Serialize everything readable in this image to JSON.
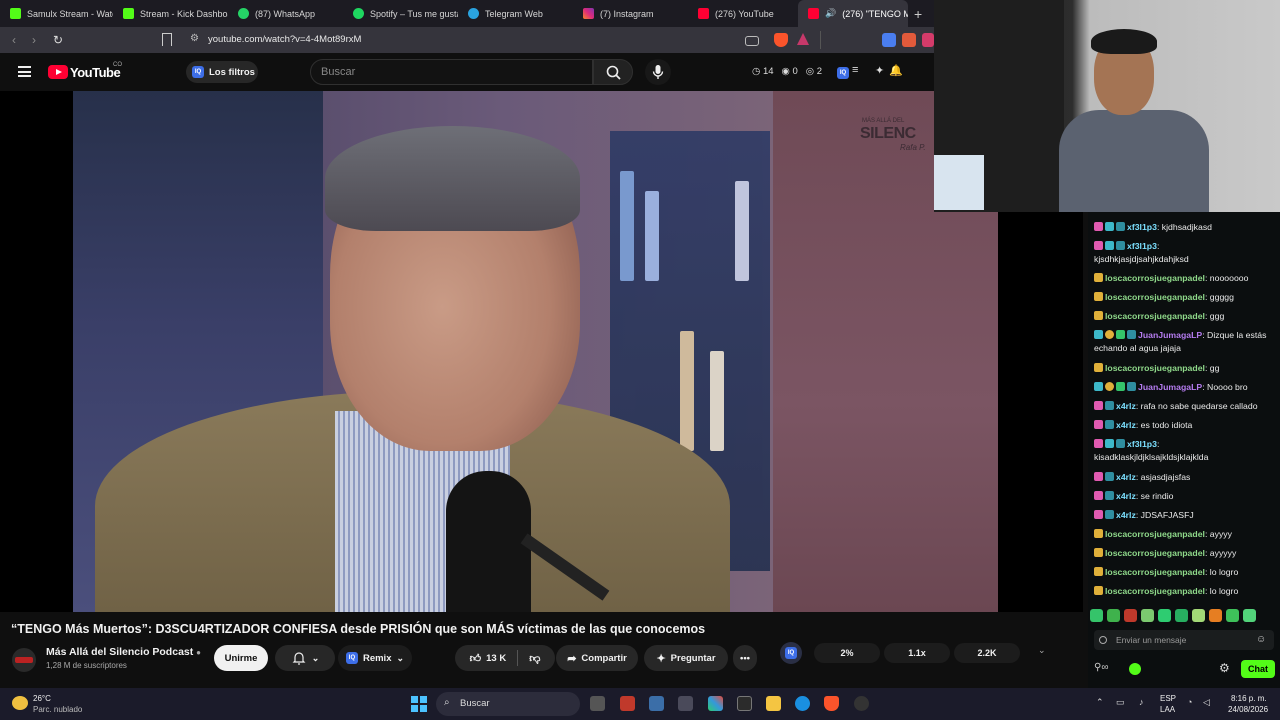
{
  "browser": {
    "tabs": [
      {
        "label": "Samulx Stream - Watch",
        "color": "#53fc18"
      },
      {
        "label": "Stream - Kick Dashboa",
        "color": "#53fc18"
      },
      {
        "label": "(87) WhatsApp",
        "color": "#25d366"
      },
      {
        "label": "Spotify – Tus me gusta",
        "color": "#1ed760"
      },
      {
        "label": "Telegram Web",
        "color": "#2aa3df"
      },
      {
        "label": "(7) Instagram",
        "color": "#e1306c"
      },
      {
        "label": "(276) YouTube",
        "color": "#ff0033"
      },
      {
        "label": "(276) \"TENGO M",
        "color": "#ff0033"
      }
    ],
    "url": "youtube.com/watch?v=4-4Mot89rxM"
  },
  "youtube": {
    "logo_text": "YouTube",
    "logo_country": "CO",
    "filters_label": "Los filtros",
    "search_placeholder": "Buscar",
    "counters": {
      "a": "14",
      "b": "0",
      "c": "2"
    }
  },
  "video": {
    "watermark_small": "MÁS ALLÁ DEL",
    "watermark_title": "SILENC",
    "watermark_sign": "Rafa P.",
    "title": "“TENGO Más Muertos”: D3SCU4RTIZADOR CONFIESA desde PRISIÓN que son MÁS víctimas de las que conocemos",
    "channel_name": "Más Allá del Silencio Podcast",
    "subscribers": "1,28 M de suscriptores",
    "join_label": "Unirme",
    "remix_label": "Remix",
    "likes": "13 K",
    "share_label": "Compartir",
    "ask_label": "Preguntar",
    "iq_stats": {
      "iq": "IQ",
      "percent": "2%",
      "speed": "1.1x",
      "count": "2.2K"
    }
  },
  "chat": {
    "messages": [
      {
        "user": "xf3l1p3",
        "text": "kjdhsadjkasd",
        "user_color": "#7ce0ff"
      },
      {
        "user": "xf3l1p3",
        "text": "kjsdhkjasjdjsahjkdahjksd",
        "user_color": "#7ce0ff"
      },
      {
        "user": "loscacorrosjueganpadel",
        "text": "nooooooo",
        "user_color": "#8fd98a"
      },
      {
        "user": "loscacorrosjueganpadel",
        "text": "ggggg",
        "user_color": "#8fd98a"
      },
      {
        "user": "loscacorrosjueganpadel",
        "text": "ggg",
        "user_color": "#8fd98a"
      },
      {
        "user": "JuanJumagaLP",
        "text": "Dizque la estás echando al agua jajaja",
        "user_color": "#b57cf0"
      },
      {
        "user": "loscacorrosjueganpadel",
        "text": "gg",
        "user_color": "#8fd98a"
      },
      {
        "user": "JuanJumagaLP",
        "text": "Noooo bro",
        "user_color": "#b57cf0"
      },
      {
        "user": "x4rlz",
        "text": "rafa no sabe quedarse callado",
        "user_color": "#7ce0ff"
      },
      {
        "user": "x4rlz",
        "text": "es todo idiota",
        "user_color": "#7ce0ff"
      },
      {
        "user": "xf3l1p3",
        "text": "kisadklaskjldjklsajkldsjklajklda",
        "user_color": "#7ce0ff"
      },
      {
        "user": "x4rlz",
        "text": "asjasdjajsfas",
        "user_color": "#7ce0ff"
      },
      {
        "user": "x4rlz",
        "text": "se rindio",
        "user_color": "#7ce0ff"
      },
      {
        "user": "x4rlz",
        "text": "JDSAFJASFJ",
        "user_color": "#7ce0ff"
      },
      {
        "user": "loscacorrosjueganpadel",
        "text": "ayyyy",
        "user_color": "#8fd98a"
      },
      {
        "user": "loscacorrosjueganpadel",
        "text": "ayyyyy",
        "user_color": "#8fd98a"
      },
      {
        "user": "loscacorrosjueganpadel",
        "text": "lo logro",
        "user_color": "#8fd98a"
      },
      {
        "user": "loscacorrosjueganpadel",
        "text": "lo logro",
        "user_color": "#8fd98a"
      }
    ],
    "input_placeholder": "Enviar un mensaje",
    "send_label": "Chat",
    "accent": "#53fc18"
  },
  "taskbar": {
    "weather_temp": "26°C",
    "weather_desc": "Parc. nublado",
    "search_label": "Buscar",
    "lang1": "ESP",
    "lang2": "LAA",
    "time": "8:16 p. m.",
    "date": "24/08/2026"
  }
}
